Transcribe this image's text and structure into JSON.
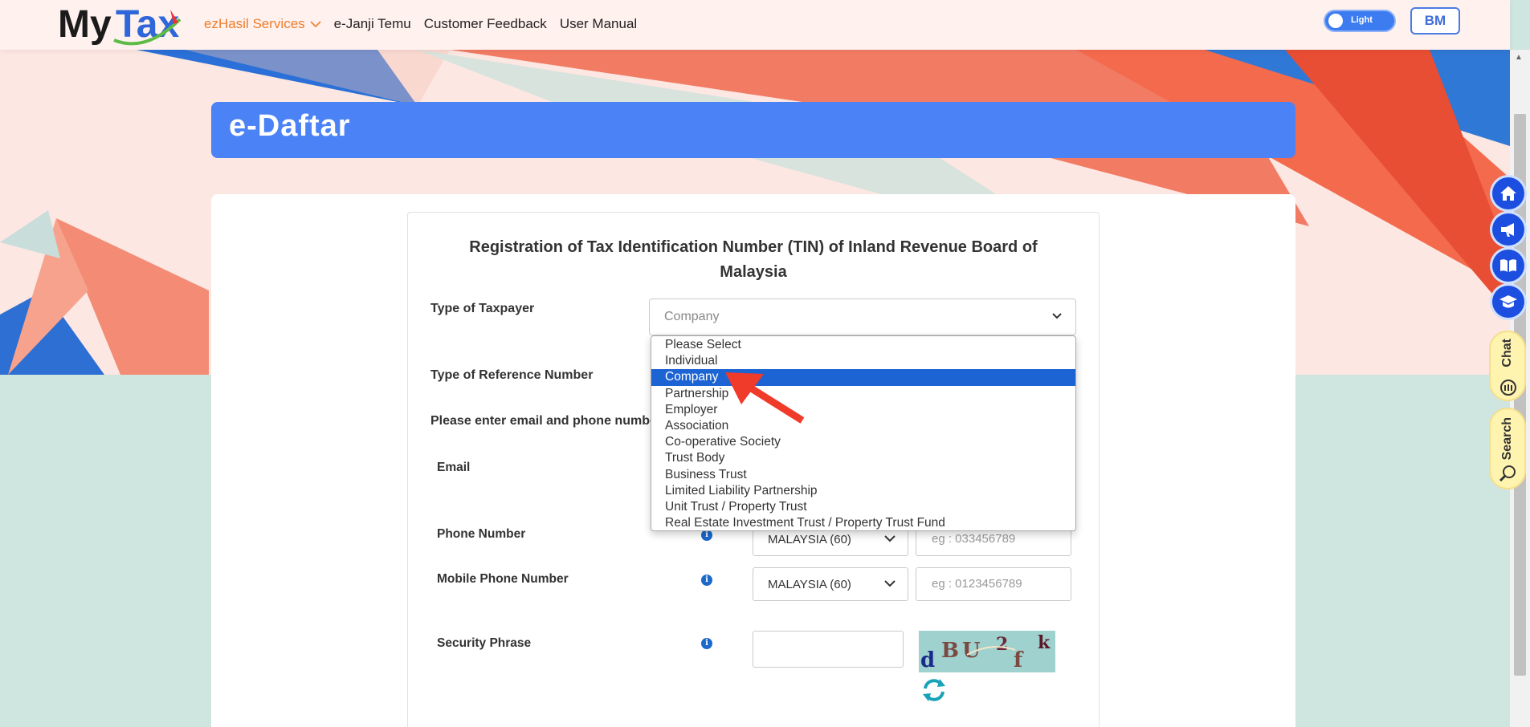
{
  "header": {
    "logo": "MyTax",
    "nav": [
      {
        "label": "ezHasil Services",
        "active": true
      },
      {
        "label": "e-Janji Temu"
      },
      {
        "label": "Customer Feedback"
      },
      {
        "label": "User Manual"
      }
    ],
    "theme_toggle": "Light",
    "lang_button": "BM"
  },
  "page": {
    "title": "e-Daftar",
    "form_title": "Registration of Tax Identification Number (TIN) of Inland Revenue Board of Malaysia"
  },
  "form": {
    "type_of_taxpayer_label": "Type of Taxpayer",
    "type_of_taxpayer_value": "Company",
    "type_of_reference_label": "Type of Reference Number",
    "contact_prompt": "Please enter email and phone number",
    "email_label": "Email",
    "phone_label": "Phone Number",
    "phone_country": "MALAYSIA (60)",
    "phone_placeholder": "eg : 033456789",
    "mobile_label": "Mobile Phone Number",
    "mobile_country": "MALAYSIA (60)",
    "mobile_placeholder": "eg : 0123456789",
    "security_label": "Security Phrase",
    "captcha": [
      "d",
      "B",
      "U",
      "2",
      "f",
      "k"
    ]
  },
  "dropdown": {
    "options": [
      "Please Select",
      "Individual",
      "Company",
      "Partnership",
      "Employer",
      "Association",
      "Co-operative Society",
      "Trust Body",
      "Business Trust",
      "Limited Liability Partnership",
      "Unit Trust / Property Trust",
      "Real Estate Investment Trust / Property Trust Fund"
    ],
    "selected_index": 2
  },
  "side": {
    "chat_label": "Chat",
    "search_label": "Search"
  },
  "colors": {
    "accent": "#4b82f5",
    "nav_active": "#ef7d2a",
    "selected": "#1c64d4",
    "annotation_arrow": "#f03a2a"
  }
}
